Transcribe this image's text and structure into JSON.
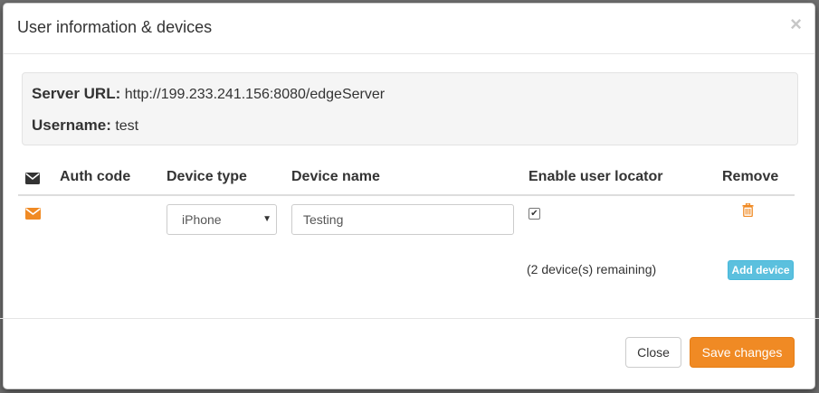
{
  "dialog": {
    "title": "User information & devices",
    "close_glyph": "×"
  },
  "info": {
    "server_url_label": "Server URL:",
    "server_url_value": "http://199.233.241.156:8080/edgeServer",
    "username_label": "Username:",
    "username_value": "test"
  },
  "table": {
    "headers": {
      "icon": "envelope-icon",
      "auth_code": "Auth code",
      "device_type": "Device type",
      "device_name": "Device name",
      "enable_locator": "Enable user locator",
      "remove": "Remove"
    },
    "rows": [
      {
        "icon": "envelope-icon",
        "auth_code": "",
        "device_type": "iPhone",
        "device_name": "Testing",
        "enable_locator": true,
        "remove_icon": "trash-icon"
      }
    ],
    "remaining_text": "(2 device(s) remaining)",
    "add_device_label": "Add device"
  },
  "footer": {
    "close_label": "Close",
    "save_label": "Save changes"
  },
  "colors": {
    "accent": "#f08a24",
    "info_button": "#5bc0de",
    "icon_orange": "#f08a24"
  }
}
